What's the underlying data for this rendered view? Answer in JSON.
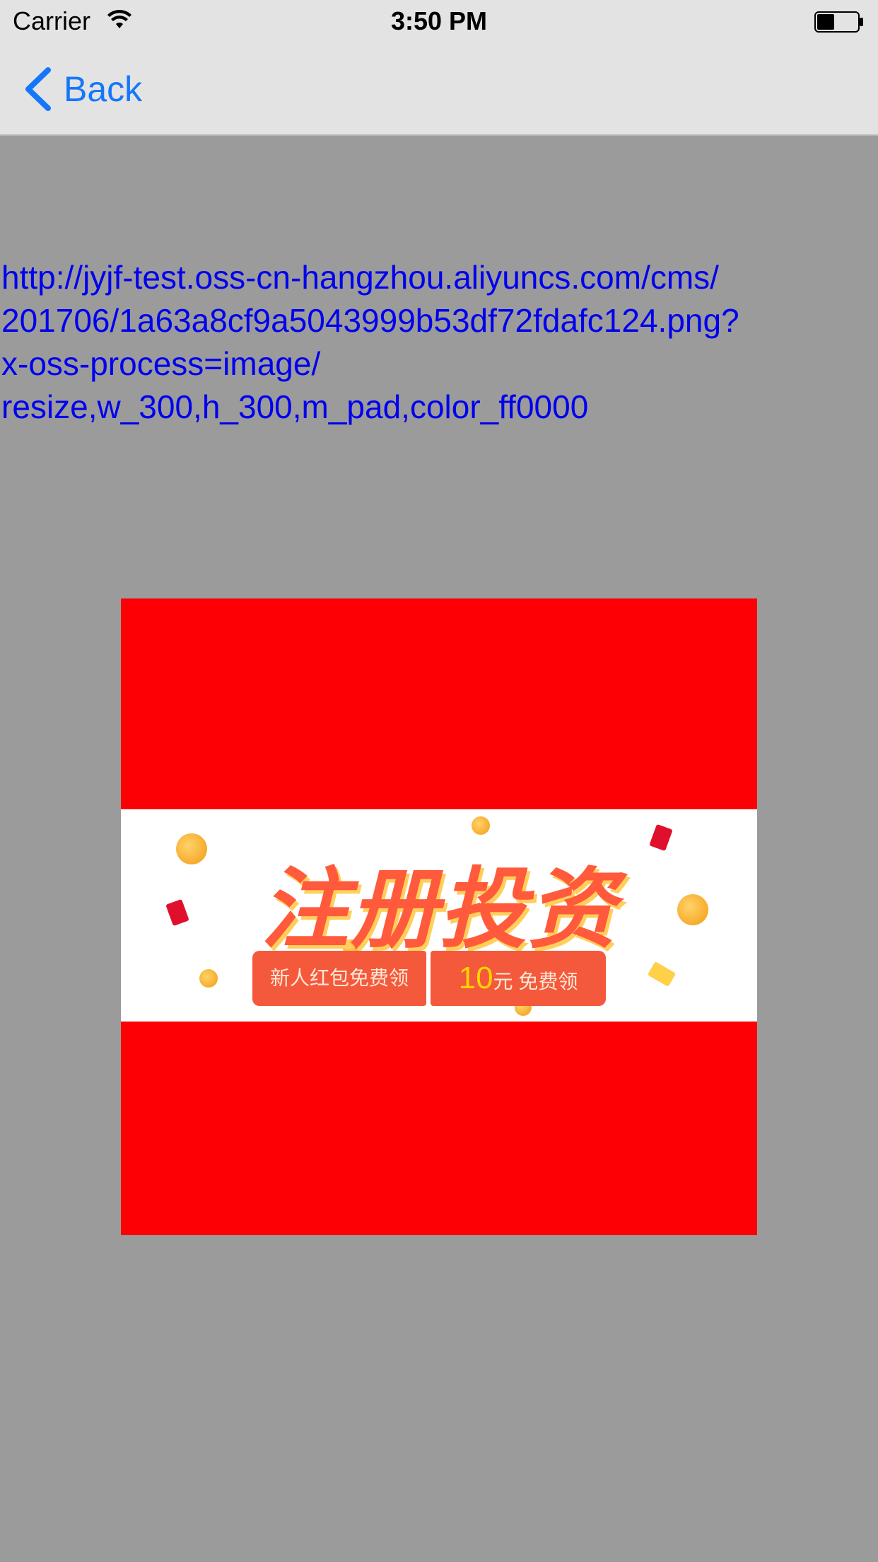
{
  "status_bar": {
    "carrier": "Carrier",
    "time": "3:50 PM"
  },
  "nav": {
    "back_label": "Back"
  },
  "content": {
    "url_lines": [
      "http://jyjf-test.oss-cn-hangzhou.aliyuncs.com/cms/",
      "201706/1a63a8cf9a5043999b53df72fdafc124.png?",
      "x-oss-process=image/",
      "resize,w_300,h_300,m_pad,color_ff0000"
    ]
  },
  "banner": {
    "title": "注册投资",
    "ticket_left": "新人红包免费领",
    "ticket_amount": "10",
    "ticket_unit": "元",
    "ticket_right_suffix": "免费领"
  },
  "colors": {
    "link": "#0000ee",
    "accent": "#1477fb",
    "background": "#9b9b9b",
    "pad_color": "#fd0006"
  },
  "icons": {
    "wifi": "wifi-icon",
    "battery": "battery-icon",
    "back": "chevron-left-icon"
  }
}
